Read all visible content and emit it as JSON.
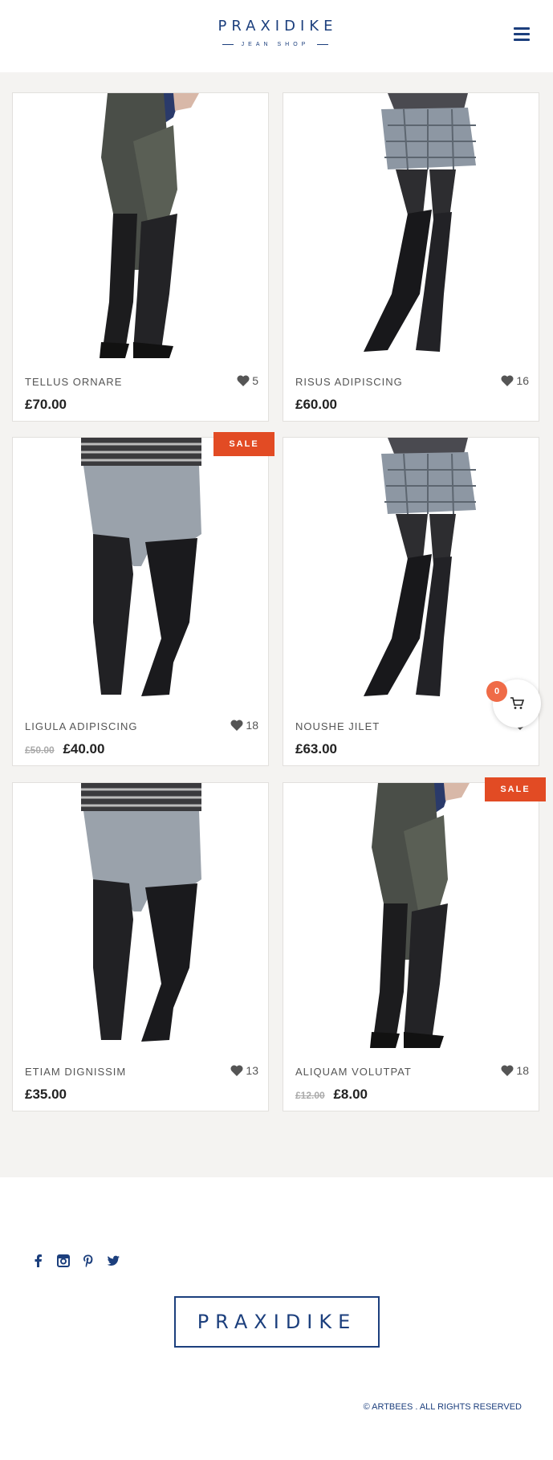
{
  "header": {
    "logo": "PRAXIDIKE",
    "tagline": "JEAN SHOP",
    "menu_icon": "hamburger-icon"
  },
  "products": [
    {
      "name": "TELLUS ORNARE",
      "likes": "5",
      "price": "£70.00",
      "old_price": "",
      "sale": false,
      "image": "dark-jeans-boots"
    },
    {
      "name": "RISUS ADIPISCING",
      "likes": "16",
      "price": "£60.00",
      "old_price": "",
      "sale": false,
      "image": "plaid-skirt-boots"
    },
    {
      "name": "LIGULA ADIPISCING",
      "likes": "18",
      "price": "£40.00",
      "old_price": "£50.00",
      "sale": true,
      "image": "grey-jeans-boots"
    },
    {
      "name": "NOUSHE JILET",
      "likes": "",
      "price": "£63.00",
      "old_price": "",
      "sale": false,
      "image": "plaid-skirt-boots"
    },
    {
      "name": "ETIAM DIGNISSIM",
      "likes": "13",
      "price": "£35.00",
      "old_price": "",
      "sale": false,
      "image": "grey-jeans-boots"
    },
    {
      "name": "ALIQUAM VOLUTPAT",
      "likes": "18",
      "price": "£8.00",
      "old_price": "£12.00",
      "sale": true,
      "image": "dark-jeans-boots"
    }
  ],
  "sale_label": "SALE",
  "cart": {
    "count": "0",
    "icon": "cart-icon"
  },
  "footer": {
    "social": [
      "facebook-icon",
      "instagram-icon",
      "pinterest-icon",
      "twitter-icon"
    ],
    "logo": "PRAXIDIKE",
    "copyright": "© ARTBEES . ALL RIGHTS RESERVED"
  },
  "colors": {
    "brand": "#1c3f7d",
    "sale": "#e24b24",
    "cart_badge": "#ef6b47",
    "background": "#f4f3f1"
  }
}
